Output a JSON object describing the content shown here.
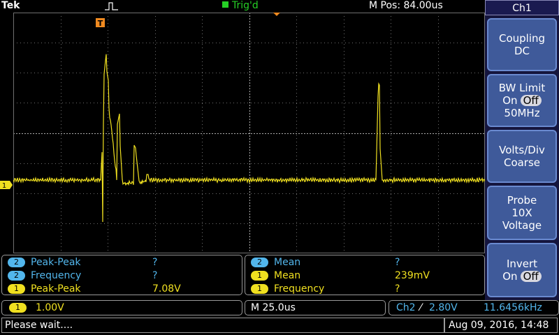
{
  "topbar": {
    "brand": "Tek",
    "trigger_status": "Trig'd",
    "position": "M Pos: 84.00us"
  },
  "colors": {
    "ch1": "#f0e020",
    "ch2": "#52b6ec",
    "trigger": "#25d025",
    "marker": "#f08a20",
    "menu_button": "#3f5a9a"
  },
  "channel_marker": "1",
  "trigger_marker": "T",
  "menu": {
    "title": "Ch1",
    "coupling": {
      "label": "Coupling",
      "value": "DC"
    },
    "bw_limit": {
      "label": "BW Limit",
      "on": "On",
      "off": "Off",
      "value": "50MHz"
    },
    "volts_div": {
      "label": "Volts/Div",
      "value": "Coarse"
    },
    "probe": {
      "label": "Probe",
      "value": "10X",
      "type": "Voltage"
    },
    "invert": {
      "label": "Invert",
      "on": "On",
      "off": "Off"
    }
  },
  "measurements_left": [
    {
      "channel": "2",
      "label": "Peak-Peak",
      "value": "?"
    },
    {
      "channel": "2",
      "label": "Frequency",
      "value": "?"
    },
    {
      "channel": "1",
      "label": "Peak-Peak",
      "value": "7.08V"
    }
  ],
  "measurements_right": [
    {
      "channel": "2",
      "label": "Mean",
      "value": "?"
    },
    {
      "channel": "1",
      "label": "Mean",
      "value": "239mV"
    },
    {
      "channel": "1",
      "label": "Frequency",
      "value": "?"
    }
  ],
  "status": {
    "ch1_channel": "1",
    "ch1_scale": "1.00V",
    "timebase": "M 25.0us",
    "trigger_source": "Ch2",
    "trigger_slope": "⁄",
    "trigger_level": "2.80V",
    "trigger_freq": "11.6456kHz",
    "message": "Please wait....",
    "datetime": "Aug 09, 2016, 14:48"
  }
}
